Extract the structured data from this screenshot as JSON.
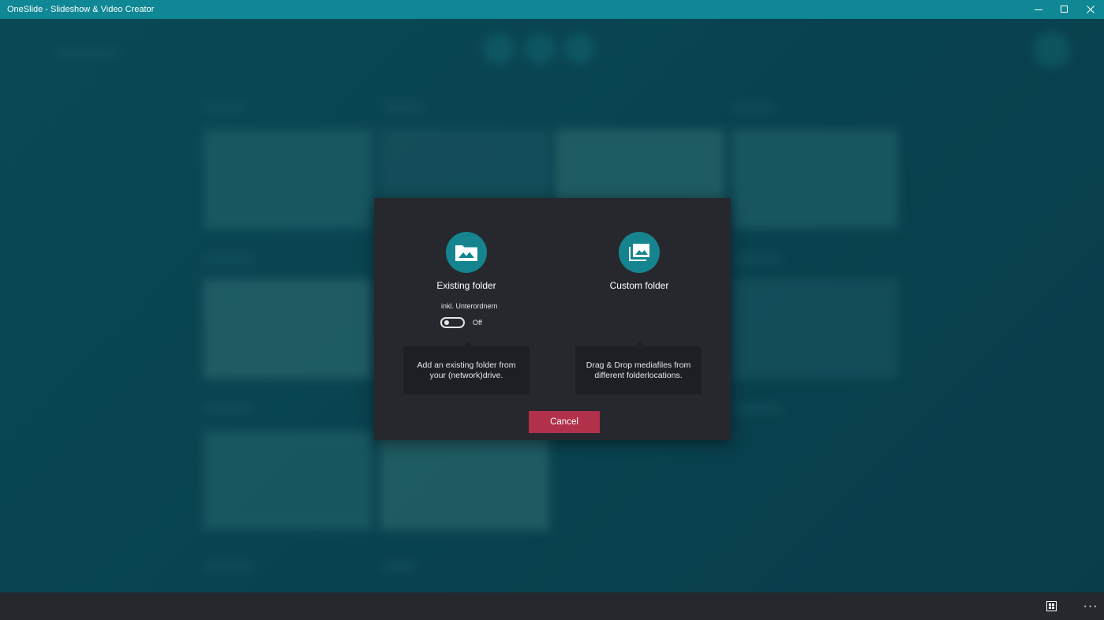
{
  "window": {
    "title": "OneSlide - Slideshow & Video Creator",
    "controls": [
      "minimize-icon",
      "maximize-icon",
      "close-icon"
    ]
  },
  "dialog": {
    "existing_folder": {
      "title": "Existing folder",
      "icon": "folder-image-icon",
      "toggle_label": "inkl. Unterordnern",
      "toggle_state": "Off",
      "tooltip": "Add an existing folder from your (network)drive."
    },
    "custom_folder": {
      "title": "Custom folder",
      "icon": "image-stack-icon",
      "tooltip": "Drag & Drop mediafiles from different folderlocations."
    },
    "cancel_label": "Cancel"
  },
  "command_bar": {
    "icons": [
      "grid-view-icon",
      "more-options-icon"
    ],
    "more_label": "···"
  },
  "colors": {
    "titlebar": "#0f8794",
    "accent_circle": "#15848f",
    "dialog_bg": "#26282e",
    "tooltip_bg": "#1d1f24",
    "cancel": "#b1304a"
  }
}
